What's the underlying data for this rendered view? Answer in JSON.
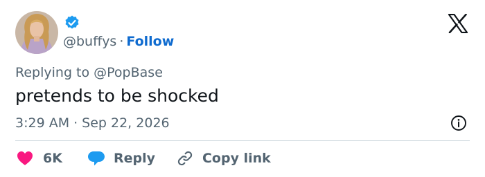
{
  "author": {
    "handle": "@buffys",
    "follow_label": "Follow",
    "separator": "·",
    "verified": true,
    "verified_color": "#1d9bf0",
    "avatar": "profile-photo-woman-blonde"
  },
  "brand_icon": "x-logo-icon",
  "reply_context": "Replying to @PopBase",
  "tweet": {
    "text": "pretends to be shocked"
  },
  "meta": {
    "time": "3:29 AM",
    "separator": "·",
    "date": "Sep 22, 2026",
    "info_icon": "info-icon"
  },
  "actions": {
    "likes": {
      "icon": "heart-icon",
      "count": "6K",
      "color": "#f91880"
    },
    "reply": {
      "icon": "chat-bubble-icon",
      "label": "Reply",
      "color": "#1d9bf0"
    },
    "copy_link": {
      "icon": "link-icon",
      "label": "Copy link"
    }
  },
  "colors": {
    "text": "#0f1419",
    "muted": "#536471",
    "link": "#0f6bcf",
    "divider": "#cfd9de"
  }
}
